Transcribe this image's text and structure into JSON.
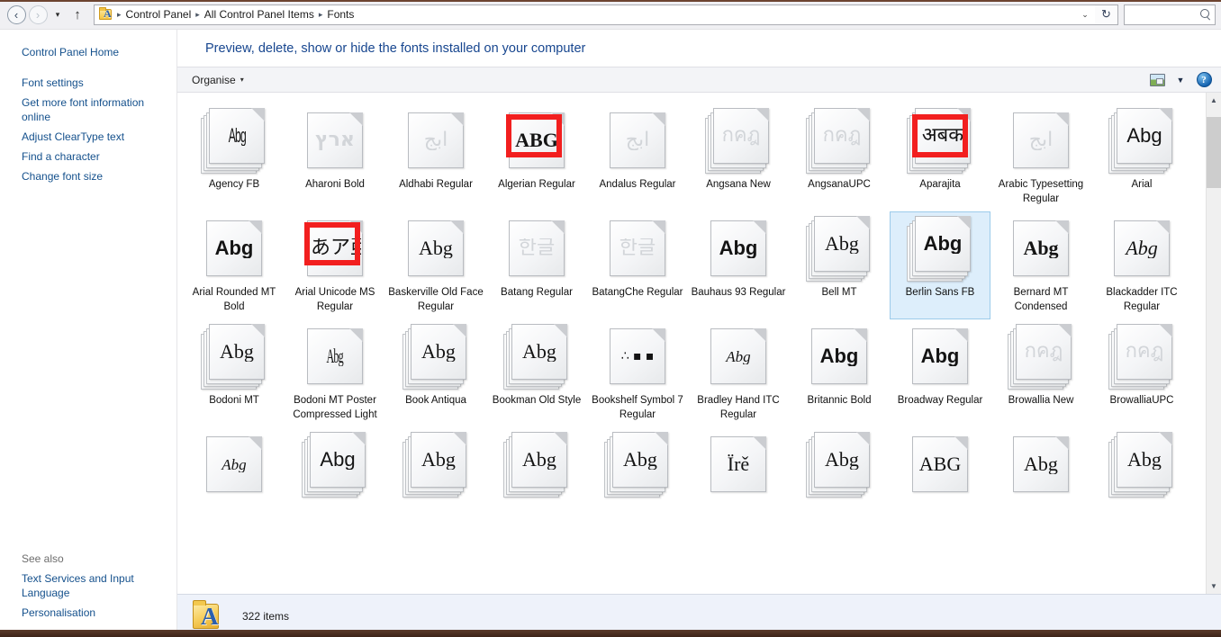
{
  "window": {
    "top_accent_color": "#6d4430"
  },
  "navbar": {
    "back_label": "‹",
    "forward_label": "›",
    "recent_caret": "▾",
    "up_label": "↑",
    "breadcrumb": [
      "Control Panel",
      "All Control Panel Items",
      "Fonts"
    ],
    "breadcrumb_separator": "▸",
    "dropdown_caret": "⌄",
    "refresh_label": "↻",
    "search_placeholder": "",
    "search_value": "",
    "search_icon": "search-icon"
  },
  "taskpane": {
    "home_label": "Control Panel Home",
    "links": [
      "Font settings",
      "Get more font information online",
      "Adjust ClearType text",
      "Find a character",
      "Change font size"
    ],
    "see_also_label": "See also",
    "see_also_links": [
      "Text Services and Input Language",
      "Personalisation"
    ]
  },
  "content": {
    "heading": "Preview, delete, show or hide the fonts installed on your computer",
    "heading_color": "#17468f",
    "toolbar": {
      "organise_label": "Organise",
      "organise_caret": "▾",
      "view_icon": "view-layout-icon",
      "view_caret": "▼",
      "help_icon": "help-icon",
      "help_glyph": "?"
    }
  },
  "scrollbar": {
    "up_arrow": "▲",
    "down_arrow": "▼",
    "thumb_position_pct": 2,
    "thumb_size_pct": 15
  },
  "statusbar": {
    "item_count_label": "322 items",
    "folder_icon": "fonts-folder-icon",
    "folder_letter": "A"
  },
  "annotations": {
    "color": "#f21f1f",
    "boxes": [
      {
        "target": "Algerian Regular"
      },
      {
        "target": "Aparajita"
      },
      {
        "target": "Arial Unicode MS Regular"
      }
    ]
  },
  "grid": {
    "selected_font": "Berlin Sans FB",
    "tiles": [
      {
        "name": "Agency FB",
        "glyph": "Abg",
        "style": "sans narrow-ish",
        "faint": false,
        "stacked": true,
        "annotated": false
      },
      {
        "name": "Aharoni Bold",
        "glyph": "ארץ",
        "style": "dv bold",
        "faint": true,
        "stacked": false,
        "annotated": false
      },
      {
        "name": "Aldhabi Regular",
        "glyph": "أبج",
        "style": "dv",
        "faint": true,
        "stacked": false,
        "annotated": false
      },
      {
        "name": "Algerian Regular",
        "glyph": "ABG",
        "style": "serif bold",
        "faint": false,
        "stacked": false,
        "annotated": true
      },
      {
        "name": "Andalus Regular",
        "glyph": "أبج",
        "style": "dv",
        "faint": true,
        "stacked": false,
        "annotated": false
      },
      {
        "name": "Angsana New",
        "glyph": "กคฎ",
        "style": "dv",
        "faint": true,
        "stacked": true,
        "annotated": false
      },
      {
        "name": "AngsanaUPC",
        "glyph": "กคฎ",
        "style": "dv",
        "faint": true,
        "stacked": true,
        "annotated": false
      },
      {
        "name": "Aparajita",
        "glyph": "अबक",
        "style": "dv",
        "faint": false,
        "stacked": true,
        "annotated": true
      },
      {
        "name": "Arabic Typesetting Regular",
        "glyph": "أبج",
        "style": "dv",
        "faint": true,
        "stacked": false,
        "annotated": false
      },
      {
        "name": "Arial",
        "glyph": "Abg",
        "style": "sans",
        "faint": false,
        "stacked": true,
        "annotated": false
      },
      {
        "name": "Arial Rounded MT Bold",
        "glyph": "Abg",
        "style": "sans bold",
        "faint": false,
        "stacked": false,
        "annotated": false
      },
      {
        "name": "Arial Unicode MS Regular",
        "glyph": "あア亜",
        "style": "dv",
        "faint": false,
        "stacked": false,
        "annotated": true
      },
      {
        "name": "Baskerville Old Face Regular",
        "glyph": "Abg",
        "style": "serif",
        "faint": false,
        "stacked": false,
        "annotated": false
      },
      {
        "name": "Batang Regular",
        "glyph": "한글",
        "style": "dv",
        "faint": true,
        "stacked": false,
        "annotated": false
      },
      {
        "name": "BatangChe Regular",
        "glyph": "한글",
        "style": "dv",
        "faint": true,
        "stacked": false,
        "annotated": false
      },
      {
        "name": "Bauhaus 93 Regular",
        "glyph": "Abg",
        "style": "sans bold",
        "faint": false,
        "stacked": false,
        "annotated": false
      },
      {
        "name": "Bell MT",
        "glyph": "Abg",
        "style": "serif",
        "faint": false,
        "stacked": true,
        "annotated": false
      },
      {
        "name": "Berlin Sans FB",
        "glyph": "Abg",
        "style": "sans bold",
        "faint": false,
        "stacked": true,
        "annotated": false
      },
      {
        "name": "Bernard MT Condensed",
        "glyph": "Abg",
        "style": "serif bold",
        "faint": false,
        "stacked": false,
        "annotated": false
      },
      {
        "name": "Blackadder ITC Regular",
        "glyph": "Abg",
        "style": "serif ital",
        "faint": false,
        "stacked": false,
        "annotated": false
      },
      {
        "name": "Bodoni MT",
        "glyph": "Abg",
        "style": "serif",
        "faint": false,
        "stacked": true,
        "annotated": false
      },
      {
        "name": "Bodoni MT Poster Compressed Light",
        "glyph": "Abg",
        "style": "serif narrow",
        "faint": false,
        "stacked": false,
        "annotated": false
      },
      {
        "name": "Book Antiqua",
        "glyph": "Abg",
        "style": "serif",
        "faint": false,
        "stacked": true,
        "annotated": false
      },
      {
        "name": "Bookman Old Style",
        "glyph": "Abg",
        "style": "serif",
        "faint": false,
        "stacked": true,
        "annotated": false
      },
      {
        "name": "Bookshelf Symbol 7 Regular",
        "glyph": "∴ ▪ ▪",
        "style": "dv xs",
        "faint": false,
        "stacked": false,
        "annotated": false
      },
      {
        "name": "Bradley Hand ITC Regular",
        "glyph": "Abg",
        "style": "serif ital sm",
        "faint": false,
        "stacked": false,
        "annotated": false
      },
      {
        "name": "Britannic Bold",
        "glyph": "Abg",
        "style": "sans bold",
        "faint": false,
        "stacked": false,
        "annotated": false
      },
      {
        "name": "Broadway Regular",
        "glyph": "Abg",
        "style": "sans bold",
        "faint": false,
        "stacked": false,
        "annotated": false
      },
      {
        "name": "Browallia New",
        "glyph": "กคฎ",
        "style": "dv",
        "faint": true,
        "stacked": true,
        "annotated": false
      },
      {
        "name": "BrowalliaUPC",
        "glyph": "กคฎ",
        "style": "dv",
        "faint": true,
        "stacked": true,
        "annotated": false
      },
      {
        "name": "",
        "glyph": "Abg",
        "style": "serif ital sm",
        "faint": false,
        "stacked": false,
        "annotated": false
      },
      {
        "name": "",
        "glyph": "Abg",
        "style": "sans",
        "faint": false,
        "stacked": true,
        "annotated": false
      },
      {
        "name": "",
        "glyph": "Abg",
        "style": "serif",
        "faint": false,
        "stacked": true,
        "annotated": false
      },
      {
        "name": "",
        "glyph": "Abg",
        "style": "serif",
        "faint": false,
        "stacked": true,
        "annotated": false
      },
      {
        "name": "",
        "glyph": "Abg",
        "style": "serif",
        "faint": false,
        "stacked": true,
        "annotated": false
      },
      {
        "name": "",
        "glyph": "Ïrě",
        "style": "serif",
        "faint": false,
        "stacked": false,
        "annotated": false
      },
      {
        "name": "",
        "glyph": "Abg",
        "style": "serif",
        "faint": false,
        "stacked": true,
        "annotated": false
      },
      {
        "name": "",
        "glyph": "ABG",
        "style": "serif",
        "faint": false,
        "stacked": false,
        "annotated": false
      },
      {
        "name": "",
        "glyph": "Abg",
        "style": "serif",
        "faint": false,
        "stacked": false,
        "annotated": false
      },
      {
        "name": "",
        "glyph": "Abg",
        "style": "serif",
        "faint": false,
        "stacked": true,
        "annotated": false
      }
    ]
  }
}
